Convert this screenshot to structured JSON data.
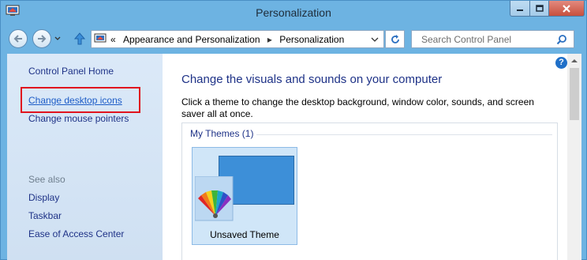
{
  "window": {
    "title": "Personalization"
  },
  "navigation": {
    "breadcrumb_root_chevrons": "«",
    "breadcrumb": [
      "Appearance and Personalization",
      "Personalization"
    ],
    "breadcrumb_separator": "▸",
    "search_placeholder": "Search Control Panel"
  },
  "sidebar": {
    "home_link": "Control Panel Home",
    "links": [
      "Change desktop icons",
      "Change mouse pointers"
    ],
    "see_also_label": "See also",
    "see_also": [
      "Display",
      "Taskbar",
      "Ease of Access Center"
    ]
  },
  "main": {
    "title": "Change the visuals and sounds on your computer",
    "description": "Click a theme to change the desktop background, window color, sounds, and screen saver all at once.",
    "themes_header": "My Themes (1)",
    "theme_name": "Unsaved Theme",
    "help_glyph": "?"
  },
  "colors": {
    "frame": "#6db3e2",
    "link": "#1e3287",
    "highlight_border": "#e0141e",
    "desktop_thumb": "#3d8fd8"
  }
}
